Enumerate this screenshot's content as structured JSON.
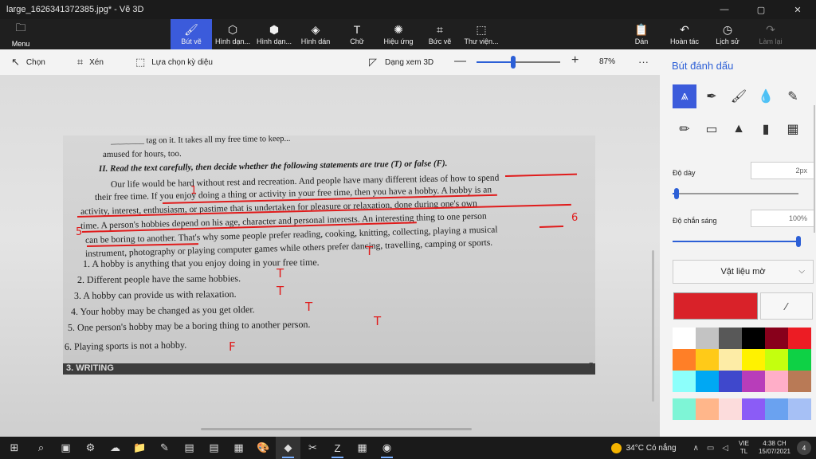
{
  "window": {
    "title": "large_1626341372385.jpg* - Vẽ 3D",
    "min": "—",
    "max": "▢",
    "close": "✕"
  },
  "ribbon": {
    "menu_label": "Menu",
    "tools": [
      {
        "id": "brushes",
        "label": "Bút vẽ",
        "icon": "brush-icon",
        "glyph": "🖌",
        "active": true
      },
      {
        "id": "2d-shapes",
        "label": "Hình dạn...",
        "icon": "2d-shapes-icon",
        "glyph": "⬡"
      },
      {
        "id": "3d-shapes",
        "label": "Hình dạn...",
        "icon": "3d-shapes-icon",
        "glyph": "⬢"
      },
      {
        "id": "stickers",
        "label": "Hình dán",
        "icon": "sticker-icon",
        "glyph": "◈"
      },
      {
        "id": "text",
        "label": "Chữ",
        "icon": "text-icon",
        "glyph": "T"
      },
      {
        "id": "effects",
        "label": "Hiệu ứng",
        "icon": "effects-icon",
        "glyph": "✺"
      },
      {
        "id": "canvas",
        "label": "Bức vẽ",
        "icon": "canvas-icon",
        "glyph": "⌗"
      },
      {
        "id": "library",
        "label": "Thư viện...",
        "icon": "3d-library-icon",
        "glyph": "⬚"
      }
    ],
    "right_tools": [
      {
        "id": "paste",
        "label": "Dán",
        "icon": "paste-icon",
        "glyph": "📋",
        "disabled": false
      },
      {
        "id": "undo",
        "label": "Hoàn tác",
        "icon": "undo-icon",
        "glyph": "↶",
        "disabled": false
      },
      {
        "id": "history",
        "label": "Lịch sử",
        "icon": "history-icon",
        "glyph": "◷",
        "disabled": false
      },
      {
        "id": "redo",
        "label": "Làm lại",
        "icon": "redo-icon",
        "glyph": "↷",
        "disabled": true
      }
    ]
  },
  "subbar": {
    "select": "Chọn",
    "crop": "Xén",
    "magic_select": "Lựa chọn kỳ diệu",
    "view_3d": "Dạng xem 3D",
    "zoom_minus": "—",
    "zoom_plus": "+",
    "zoom_pct": "87%",
    "zoom_fraction": 0.44,
    "more": "···"
  },
  "photo": {
    "lines": [
      {
        "text": "________ tag on it. It takes all my free time to keep...",
        "red": false
      },
      {
        "text": "amused for hours, too.",
        "red": false
      },
      {
        "text": "II.  Read the text carefully, then decide whether the following statements are true (T) or false (F).",
        "red": false
      },
      {
        "text": "Our life would be hard without rest and recreation. And people have many different ideas of how to spend",
        "red": false
      },
      {
        "text": "their free time. If you enjoy doing a thing or activity in your free time, then you have a hobby. A hobby is an",
        "red": false
      },
      {
        "text": "activity, interest, enthusiasm, or pastime that is undertaken for pleasure or relaxation, done during one's own",
        "red": false
      },
      {
        "text": "time. A person's hobbies depend on his age, character and personal interests. An interesting thing to one person",
        "red": false
      },
      {
        "text": "can be boring to another. That's why some people prefer reading, cooking, knitting, collecting, playing a musical",
        "red": false
      },
      {
        "text": "instrument, photography or playing computer games while others prefer dancing, travelling, camping or sports.",
        "red": false
      },
      {
        "text": "1.  A hobby is anything that you enjoy doing in your free time.",
        "red": false
      },
      {
        "text": "2.  Different people have the same hobbies.",
        "red": false
      },
      {
        "text": "3.  A hobby can provide us with relaxation.",
        "red": false
      },
      {
        "text": "4.  Your hobby may be changed as you get older.",
        "red": false
      },
      {
        "text": "5.  One person's hobby may be a boring thing to another person.",
        "red": false
      },
      {
        "text": "6.  Playing sports is not a hobby.",
        "red": false
      }
    ],
    "answers": [
      "T",
      "T",
      "T",
      "T",
      "T",
      "F"
    ],
    "marks": [
      "1",
      "5",
      "6"
    ],
    "bottom_strip": "3. WRITING",
    "edge_number": "7"
  },
  "panel": {
    "title": "Bút đánh dấu",
    "brushes": [
      {
        "name": "marker-brush-icon",
        "glyph": "⩓",
        "selected": true
      },
      {
        "name": "calligraphy-pen-icon",
        "glyph": "✒"
      },
      {
        "name": "oil-brush-icon",
        "glyph": "🖌"
      },
      {
        "name": "watercolor-icon",
        "glyph": "💧"
      },
      {
        "name": "pixel-pen-icon",
        "glyph": "✎"
      },
      {
        "name": "pencil-icon",
        "glyph": "✏"
      },
      {
        "name": "eraser-icon",
        "glyph": "▭"
      },
      {
        "name": "crayon-icon",
        "glyph": "▲"
      },
      {
        "name": "spray-can-icon",
        "glyph": "▮"
      },
      {
        "name": "fill-bucket-icon",
        "glyph": "▦"
      }
    ],
    "thickness_label": "Độ dày",
    "thickness_value": "2px",
    "thickness_fraction": 0.03,
    "opacity_label": "Độ chắn sáng",
    "opacity_value": "100%",
    "opacity_fraction": 1.0,
    "material": "Vật liệu mờ",
    "current_color": "#d92229",
    "palette": [
      "#ffffff",
      "#c3c3c3",
      "#585858",
      "#000000",
      "#88001b",
      "#ec1c24",
      "#ff7f27",
      "#ffca18",
      "#fdeca6",
      "#fff200",
      "#c4ff0e",
      "#0ed145",
      "#8cfffb",
      "#00a8f3",
      "#3f48cc",
      "#b83dba",
      "#ffaec8",
      "#b97a56"
    ],
    "palette2": [
      "#7ef5d6",
      "#ffb68a",
      "#fcdcdc",
      "#8b5cf6",
      "#6aa2f0",
      "#a6c0f5"
    ]
  },
  "taskbar": {
    "apps": [
      {
        "name": "start-icon",
        "glyph": "⊞",
        "on": false
      },
      {
        "name": "search-icon",
        "glyph": "⌕",
        "on": false
      },
      {
        "name": "task-view-icon",
        "glyph": "▣",
        "on": false
      },
      {
        "name": "settings-icon",
        "glyph": "⚙",
        "on": false
      },
      {
        "name": "weather-app-icon",
        "glyph": "☁",
        "on": false
      },
      {
        "name": "file-explorer-icon",
        "glyph": "📁",
        "on": false
      },
      {
        "name": "sticky-notes-icon",
        "glyph": "✎",
        "on": false
      },
      {
        "name": "slides-icon",
        "glyph": "▤",
        "on": false
      },
      {
        "name": "docs-icon",
        "glyph": "▤",
        "on": false
      },
      {
        "name": "sheets-icon",
        "glyph": "▦",
        "on": false
      },
      {
        "name": "paint-icon",
        "glyph": "🎨",
        "on": false
      },
      {
        "name": "paint-3d-icon",
        "glyph": "◆",
        "on": true,
        "current": true
      },
      {
        "name": "snip-icon",
        "glyph": "✂",
        "on": false
      },
      {
        "name": "zalo-icon",
        "glyph": "Z",
        "on": true
      },
      {
        "name": "calculator-icon",
        "glyph": "▦",
        "on": false
      },
      {
        "name": "chrome-icon",
        "glyph": "◉",
        "on": true
      }
    ],
    "weather": "34°C  Có nắng",
    "lang_top": "VIE",
    "lang_bottom": "TL",
    "time": "4:38 CH",
    "date": "15/07/2021",
    "notifications": "4"
  }
}
